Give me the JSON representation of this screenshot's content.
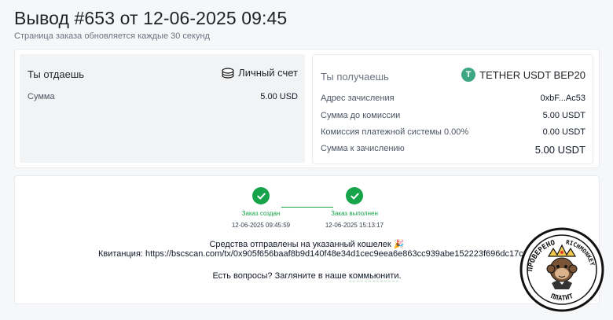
{
  "header": {
    "title": "Вывод #653 от 12-06-2025 09:45",
    "subtitle": "Страница заказа обновляется каждые 30 секунд"
  },
  "give": {
    "title": "Ты отдаешь",
    "method": "Личный счет",
    "method_icon": "coins-icon",
    "rows": [
      {
        "label": "Сумма",
        "value": "5.00 USD"
      }
    ]
  },
  "receive": {
    "title": "Ты получаешь",
    "method": "TETHER USDT BEP20",
    "method_icon": "tether-icon",
    "logo_letter": "T",
    "rows": [
      {
        "label": "Адрес зачисления",
        "value": "0xbF...Ac53"
      },
      {
        "label": "Сумма до комиссии",
        "value": "5.00 USDT"
      },
      {
        "label": "Комиссия платежной системы 0.00%",
        "value": "0.00 USDT"
      },
      {
        "label": "Сумма к зачислению",
        "value": "5.00 USDT"
      }
    ]
  },
  "status": {
    "steps": [
      {
        "label": "Заказ создан",
        "time": "12-06-2025 09:45:59"
      },
      {
        "label": "Заказ выполнен",
        "time": "12-06-2025 15:13:17"
      }
    ],
    "sent_message": "Средства отправлены на указанный кошелек 🎉",
    "receipt_label": "Квитанция: ",
    "receipt_url": "https://bscscan.com/tx/0x905f656baaf8b9d140f48e34d1cec9eea6e863cc939abe152223f696dc17c353",
    "questions_text": "Есть вопросы? Загляните в наше ",
    "questions_link": "коммьюнити",
    "questions_end": "."
  },
  "seal": {
    "text_top": "ПРОВЕРЕНО",
    "text_right": "RICHMONKEY",
    "text_bottom": "ПЛАТИТ"
  },
  "colors": {
    "accent_green": "#16a34a",
    "tether_green": "#3fa684",
    "panel_gray": "#f2f3f5"
  }
}
